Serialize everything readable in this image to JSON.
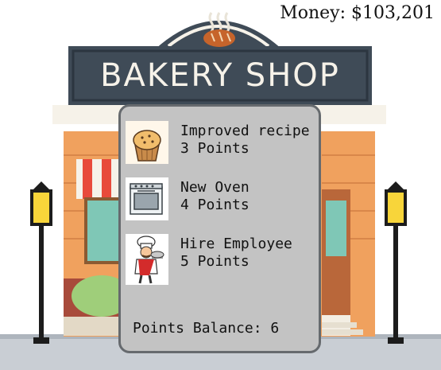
{
  "hud": {
    "money": "Money: $103,201"
  },
  "shop": {
    "sign": "BAKERY SHOP"
  },
  "upgrades": [
    {
      "name": "Improved recipe",
      "cost": "3 Points",
      "icon": "muffin-icon"
    },
    {
      "name": "New Oven",
      "cost": "4 Points",
      "icon": "oven-icon"
    },
    {
      "name": "Hire Employee",
      "cost": "5 Points",
      "icon": "chef-icon"
    }
  ],
  "points": {
    "balance": "Points Balance: 6"
  },
  "colors": {
    "sign": "#3f4b57",
    "brick": "#f0a15e",
    "awning": "#f6f2e9",
    "panel": "#c3c3c3",
    "panel_border": "#666a6e"
  }
}
